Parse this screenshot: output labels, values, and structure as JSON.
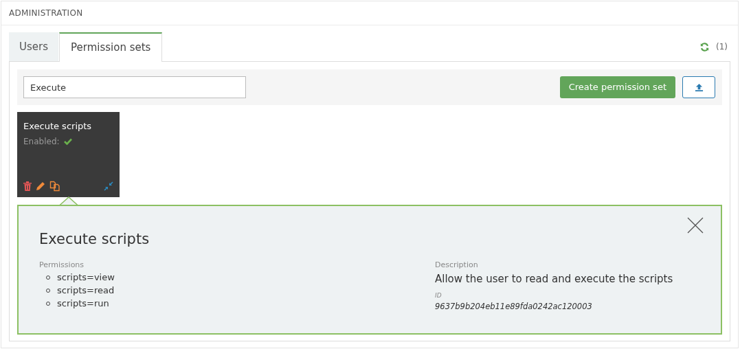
{
  "header": {
    "title": "ADMINISTRATION"
  },
  "tabs": [
    {
      "label": "Users",
      "selected": false
    },
    {
      "label": "Permission sets",
      "selected": true
    }
  ],
  "refresh": {
    "count": "(1)"
  },
  "toolbar": {
    "search": {
      "value": "Execute"
    },
    "create_button": "Create permission set"
  },
  "cards": [
    {
      "title": "Execute scripts",
      "enabled_label": "Enabled:",
      "enabled": true,
      "selected": true
    }
  ],
  "detail": {
    "title": "Execute scripts",
    "permissions_label": "Permissions",
    "permissions": [
      "scripts=view",
      "scripts=read",
      "scripts=run"
    ],
    "description_label": "Description",
    "description": "Allow the user to read and execute the scripts",
    "id_label": "ID",
    "id": "9637b9b204eb11e89fda0242ac120003"
  }
}
